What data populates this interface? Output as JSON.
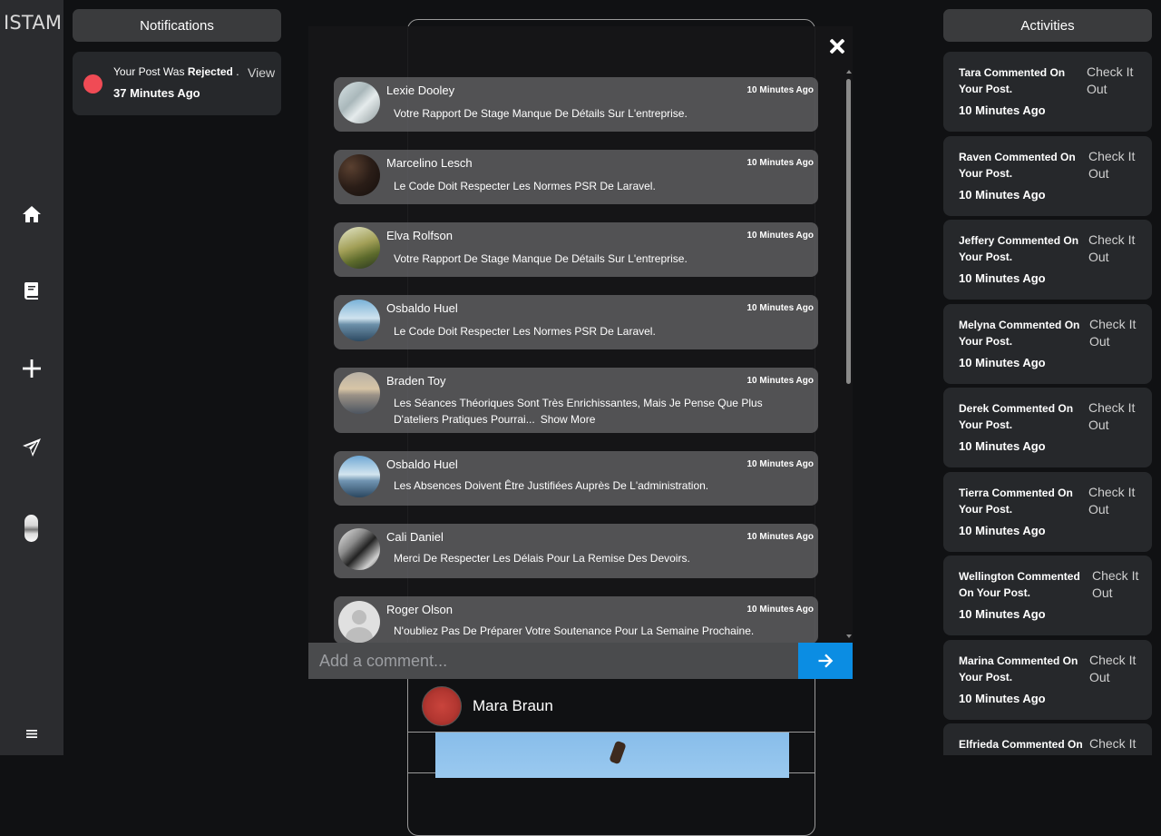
{
  "brand": "ISTAM",
  "sidebar_icons": [
    "home-icon",
    "book-icon",
    "plus-icon",
    "send-icon",
    "profile-avatar",
    "menu-icon"
  ],
  "notifications": {
    "title": "Notifications",
    "item": {
      "prefix": "Your Post Was ",
      "status": "Rejected",
      "suffix": " .",
      "time": "37 Minutes Ago",
      "action": "View"
    }
  },
  "feed": {
    "card2_author": "Mara Braun"
  },
  "modal": {
    "comments": [
      {
        "name": "Lexie Dooley",
        "time": "10 Minutes Ago",
        "text": "Votre Rapport De Stage Manque De Détails Sur L'entreprise."
      },
      {
        "name": "Marcelino Lesch",
        "time": "10 Minutes Ago",
        "text": "Le Code Doit Respecter Les Normes PSR De Laravel."
      },
      {
        "name": "Elva Rolfson",
        "time": "10 Minutes Ago",
        "text": "Votre Rapport De Stage Manque De Détails Sur L'entreprise."
      },
      {
        "name": "Osbaldo Huel",
        "time": "10 Minutes Ago",
        "text": "Le Code Doit Respecter Les Normes PSR De Laravel."
      },
      {
        "name": "Braden Toy",
        "time": "10 Minutes Ago",
        "text": "Les Séances Théoriques Sont Très Enrichissantes, Mais Je Pense Que Plus D'ateliers Pratiques Pourrai...",
        "more": "Show More"
      },
      {
        "name": "Osbaldo Huel",
        "time": "10 Minutes Ago",
        "text": "Les Absences Doivent Être Justifiées Auprès De L'administration."
      },
      {
        "name": "Cali Daniel",
        "time": "10 Minutes Ago",
        "text": "Merci De Respecter Les Délais Pour La Remise Des Devoirs."
      },
      {
        "name": "Roger Olson",
        "time": "10 Minutes Ago",
        "text": "N'oubliez Pas De Préparer Votre Soutenance Pour La Semaine Prochaine."
      }
    ],
    "comment_placeholder": "Add a comment..."
  },
  "activities": {
    "title": "Activities",
    "items": [
      {
        "text": "Tara Commented On Your Post.",
        "time": "10 Minutes Ago",
        "link": "Check It Out"
      },
      {
        "text": "Raven Commented On Your Post.",
        "time": "10 Minutes Ago",
        "link": "Check It Out"
      },
      {
        "text": "Jeffery Commented On Your Post.",
        "time": "10 Minutes Ago",
        "link": "Check It Out"
      },
      {
        "text": "Melyna Commented On Your Post.",
        "time": "10 Minutes Ago",
        "link": "Check It Out"
      },
      {
        "text": "Derek Commented On Your Post.",
        "time": "10 Minutes Ago",
        "link": "Check It Out"
      },
      {
        "text": "Tierra Commented On Your Post.",
        "time": "10 Minutes Ago",
        "link": "Check It Out"
      },
      {
        "text": "Wellington Commented On Your Post.",
        "time": "10 Minutes Ago",
        "link": "Check It Out"
      },
      {
        "text": "Marina Commented On Your Post.",
        "time": "10 Minutes Ago",
        "link": "Check It Out"
      },
      {
        "text": "Elfrieda Commented On",
        "time": "",
        "link": "Check It"
      }
    ]
  }
}
